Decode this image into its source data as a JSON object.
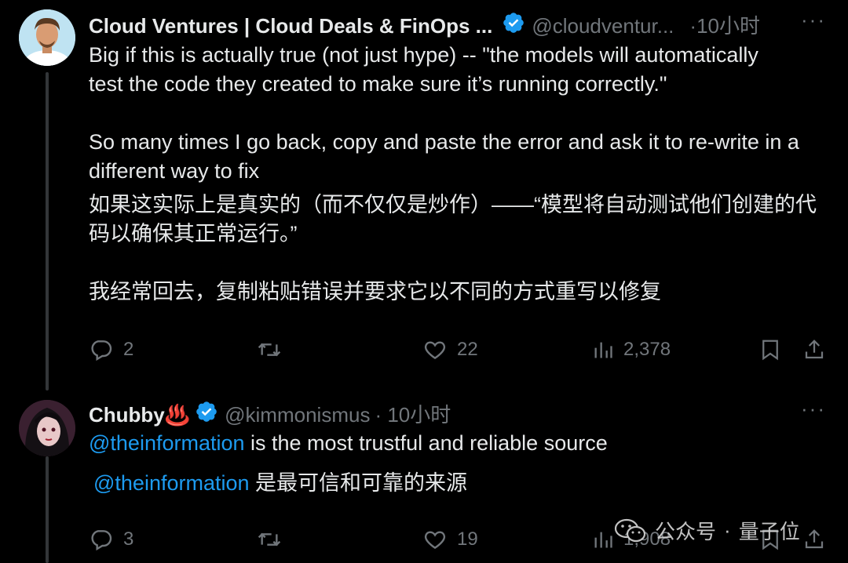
{
  "tweet1": {
    "display_name": "Cloud Ventures | Cloud Deals & FinOps ...",
    "handle": "@cloudventur...",
    "time": "·10小时",
    "body_en_1": "Big if this is actually true (not just hype) -- \"the models will automatically\ntest the code they created to make sure it’s running correctly.\"",
    "body_en_2": "So many times I go back, copy and paste the error and ask it to re-write in a\ndifferent way to fix",
    "body_zh_1": "如果这实际上是真实的（而不仅仅是炒作）——“模型将自动测试他们创建的代\n码以确保其正常运行。”",
    "body_zh_2": "我经常回去，复制粘贴错误并要求它以不同的方式重写以修复",
    "replies": "2",
    "likes": "22",
    "views": "2,378"
  },
  "tweet2": {
    "display_name": "Chubby♨️",
    "handle": "@kimmonismus",
    "time": "· 10小时",
    "mention_en": "@theinformation",
    "body_en_rest": " is the most trustful and reliable source",
    "mention_zh": "@theinformation",
    "body_zh_rest": " 是最可信和可靠的来源",
    "replies": "3",
    "likes": "19",
    "views": "1,908"
  },
  "watermark": {
    "prefix": "公众号",
    "separator": "·",
    "name": "量子位"
  },
  "colors": {
    "background": "#000000",
    "text": "#e7e9ea",
    "muted": "#71767b",
    "accent": "#1d9bf0"
  },
  "icons": [
    "verified-badge-icon",
    "more-icon",
    "reply-icon",
    "retweet-icon",
    "like-icon",
    "views-icon",
    "bookmark-icon",
    "share-icon",
    "wechat-icon"
  ]
}
